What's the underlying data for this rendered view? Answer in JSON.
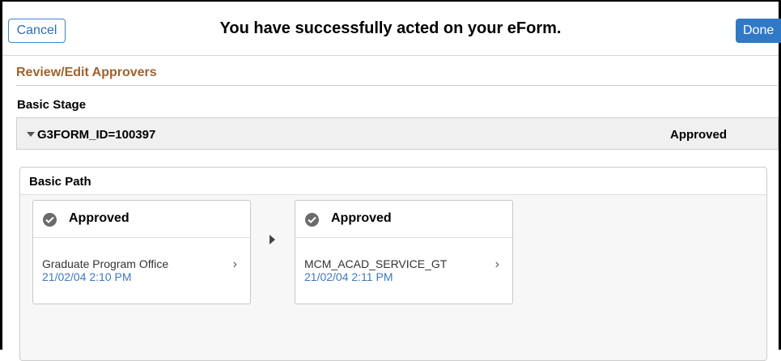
{
  "header": {
    "cancel_label": "Cancel",
    "title": "You have successfully acted on your eForm.",
    "done_label": "Done"
  },
  "section": {
    "title": "Review/Edit Approvers"
  },
  "stage": {
    "label": "Basic Stage",
    "id_text": "G3FORM_ID=100397",
    "status": "Approved"
  },
  "path": {
    "label": "Basic Path",
    "steps": [
      {
        "status": "Approved",
        "name": "Graduate Program Office",
        "timestamp": "21/02/04 2:10 PM"
      },
      {
        "status": "Approved",
        "name": "MCM_ACAD_SERVICE_GT",
        "timestamp": "21/02/04 2:11 PM"
      }
    ]
  },
  "colors": {
    "accent_blue": "#2f79c6",
    "section_title": "#a0622d",
    "timestamp": "#3e78c0"
  },
  "icons": [
    "caret-down-icon",
    "check-circle-icon",
    "chevron-right-icon",
    "arrow-right-icon"
  ]
}
